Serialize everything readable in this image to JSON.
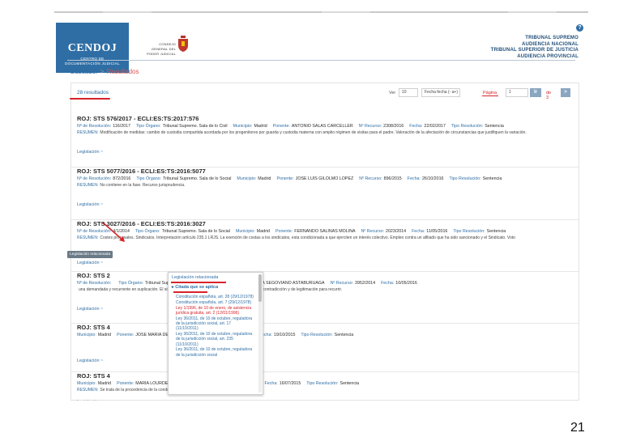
{
  "header": {
    "brand_name": "CENDOJ",
    "brand_sub_1": "CENTRO DE",
    "brand_sub_2": "DOCUMENTACIÓN JUDICIAL",
    "council_1": "CONSEJO",
    "council_2": "GENERAL DEL",
    "council_3": "PODER JUDICIAL",
    "courts": [
      "TRIBUNAL SUPREMO",
      "AUDIENCIA NACIONAL",
      "TRIBUNAL SUPERIOR DE JUSTICIA",
      "AUDIENCIA PROVINCIAL"
    ],
    "help_icon": "?"
  },
  "breadcrumb": {
    "item1": "Buscador",
    "sep": ">",
    "item2": "Resultados"
  },
  "results_count": "28 resultados",
  "controls": {
    "ver_label": "Ver",
    "ver_value": "10",
    "order_value": "Fecha fecha (- a+)",
    "page_label": "Página",
    "page_value": "1",
    "go_label": "Ir",
    "of_label": "de 3",
    "next_label": ">"
  },
  "results": [
    {
      "title": "ROJ: STS 576/2017 - ECLI:ES:TS:2017:576",
      "meta": [
        {
          "k": "Nº de Resolución:",
          "v": "116/2017"
        },
        {
          "k": "Tipo Órgano:",
          "v": "Tribunal Supremo. Sala de lo Civil"
        },
        {
          "k": "Municipio:",
          "v": "Madrid"
        },
        {
          "k": "Ponente:",
          "v": "ANTONIO SALAS CARCELLER"
        },
        {
          "k": "Nº Recurso:",
          "v": "2308/2016"
        },
        {
          "k": "Fecha:",
          "v": "22/02/2017"
        },
        {
          "k": "Tipo Resolución:",
          "v": "Sentencia"
        }
      ],
      "resumen_label": "RESUMEN:",
      "resumen": "Modificación de medidas: cambio de custodia compartida acordada por los progenitores por guarda y custodia materna con amplio régimen de visitas para el padre. Valoración de la afectación de circunstancias que justifiquen la variación.",
      "legislacion": "Legislación ~"
    },
    {
      "title": "ROJ: STS 5077/2016 - ECLI:ES:TS:2016:5077",
      "meta": [
        {
          "k": "Nº de Resolución:",
          "v": "872/2016"
        },
        {
          "k": "Tipo Órgano:",
          "v": "Tribunal Supremo. Sala de lo Social"
        },
        {
          "k": "Municipio:",
          "v": "Madrid"
        },
        {
          "k": "Ponente:",
          "v": "JOSE LUIS GILOLMO LOPEZ"
        },
        {
          "k": "Nº Recurso:",
          "v": "896/2015"
        },
        {
          "k": "Fecha:",
          "v": "26/10/2016"
        },
        {
          "k": "Tipo Resolución:",
          "v": "Sentencia"
        }
      ],
      "resumen_label": "RESUMEN:",
      "resumen": "No contiene en la fase. Recurso jurisprudencia.",
      "legislacion": "Legislación ~"
    },
    {
      "title": "ROJ: STS 3027/2016 - ECLI:ES:TS:2016:3027",
      "meta": [
        {
          "k": "Nº de Resolución:",
          "v": "4/1/2014"
        },
        {
          "k": "Tipo Órgano:",
          "v": "Tribunal Supremo. Sala de lo Social"
        },
        {
          "k": "Municipio:",
          "v": "Madrid"
        },
        {
          "k": "Ponente:",
          "v": "FERNANDO SALINAS MOLINA"
        },
        {
          "k": "Nº Recurso:",
          "v": "2023/2014"
        },
        {
          "k": "Fecha:",
          "v": "11/05/2016"
        },
        {
          "k": "Tipo Resolución:",
          "v": "Sentencia"
        }
      ],
      "resumen_label": "RESUMEN:",
      "resumen": "Costes procesales. Sindicatos. Interpretación artículo 235.1 LRJS. La exención de costas a los sindicatos, esta condicionada a que ejerciten un interés colectivo. Empleo contra un afiliado que ha sido sancionado y el Sindicato. Voto",
      "legislacion": "Legislación ~"
    },
    {
      "title": "ROJ: STS 2",
      "meta": [
        {
          "k": "Nº de Resolución:",
          "v": ""
        },
        {
          "k": "Tipo Órgano:",
          "v": "Tribunal Supremo. Sala de lo Social"
        },
        {
          "k": "Ponente:",
          "v": "MARIA LUISA SEGOVIANO ASTABURUAGA"
        },
        {
          "k": "Nº Recurso:",
          "v": "3952/2014"
        },
        {
          "k": "Fecha:",
          "v": "10/05/2016"
        }
      ],
      "resumen_label": "",
      "resumen": "una demandada y recurrente en suplicación. El sistema interesa apoyarse en la unificación, la falta de contradicción y de legitimación para recurrir.",
      "legislacion": "Legislación ~"
    },
    {
      "title": "ROJ: STS 4",
      "meta": [
        {
          "k": "Municipio:",
          "v": "Madrid"
        },
        {
          "k": "Ponente:",
          "v": "JOSE MARIA DE BIEDO VALLEJO"
        },
        {
          "k": "Nº Recurso:",
          "v": "1420/2015"
        },
        {
          "k": "Fecha:",
          "v": "19/10/2015"
        },
        {
          "k": "Tipo Resolución:",
          "v": "Sentencia"
        }
      ],
      "resumen_label": "",
      "resumen": "",
      "legislacion": "Legislación ~"
    },
    {
      "title": "ROJ: STS 4",
      "meta": [
        {
          "k": "Municipio:",
          "v": "Madrid"
        },
        {
          "k": "Ponente:",
          "v": "MARIA LOURDES ARASTEN SAHUN"
        },
        {
          "k": "Nº Recurso:",
          "v": "2946/2014"
        },
        {
          "k": "Fecha:",
          "v": "16/07/2015"
        },
        {
          "k": "Tipo Resolución:",
          "v": "Sentencia"
        }
      ],
      "resumen_label": "RESUMEN:",
      "resumen": "Se trata de la procedencia de la condena al pago de costas en suplicación.",
      "legislacion": "Legislación ~"
    }
  ],
  "badge": "Legislación relacionada",
  "popup": {
    "header": "Legislación relacionada",
    "section": "▸ Citada que se aplica",
    "items": [
      {
        "t": "Constitución española, art. 28 (29/12/1978)",
        "c": "blue"
      },
      {
        "t": "Constitución española, art. 7 (29/12/1978)",
        "c": "blue"
      },
      {
        "t": "Ley 1/1996, de 10 de enero, de asistencia jurídica gratuita, art. 2 (12/01/1996)",
        "c": "red"
      },
      {
        "t": "Ley 36/2011, de 10 de octubre, reguladora de la jurisdicción social, art. 17 (11/10/2011)",
        "c": "blue"
      },
      {
        "t": "Ley 36/2011, de 10 de octubre, reguladora de la jurisdicción social, art. 235 (11/10/2011)",
        "c": "blue"
      },
      {
        "t": "Ley 36/2011, de 10 de octubre, reguladora de la jurisdicción social",
        "c": "blue"
      }
    ]
  },
  "slide_number": "21",
  "colors": {
    "brand": "#2f6ea5",
    "annotation": "#d6232a"
  }
}
